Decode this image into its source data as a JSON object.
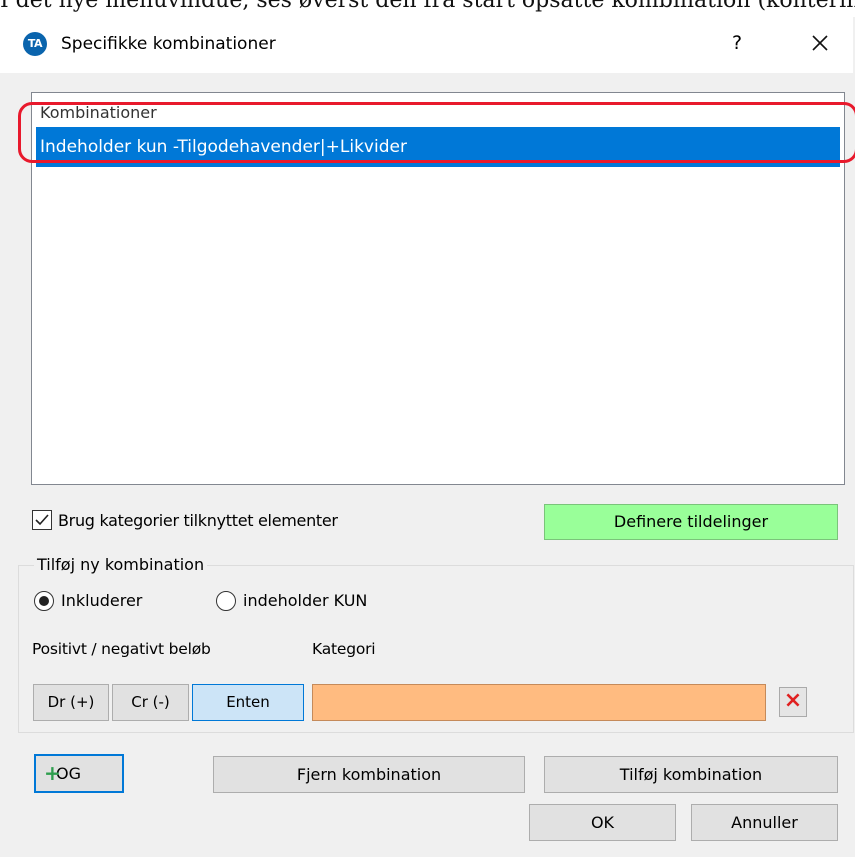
{
  "caption": "I det nye menuvindue, ses øverst den fra start opsatte kombination (konteringen",
  "window": {
    "app_icon_text": "TA",
    "title": "Specifikke kombinationer",
    "help_label": "?",
    "close_label": "Close"
  },
  "list": {
    "header": "Kombinationer",
    "rows": [
      {
        "label": "Indeholder kun -Tilgodehavender|+Likvider",
        "selected": true
      }
    ]
  },
  "use_categories": {
    "label": "Brug kategorier tilknyttet elementer",
    "checked": true
  },
  "define_button": "Definere tildelinger",
  "new_combination": {
    "legend": "Tilføj ny kombination",
    "radio_options": [
      {
        "label": "Inkluderer",
        "selected": true
      },
      {
        "label": "indeholder KUN",
        "selected": false
      }
    ],
    "amount_label": "Positivt / negativt beløb",
    "category_label": "Kategori",
    "amount_buttons": [
      {
        "label": "Dr (+)",
        "active": false
      },
      {
        "label": "Cr (-)",
        "active": false
      },
      {
        "label": "Enten",
        "active": true
      }
    ],
    "category_value": "",
    "clear_icon": "x-icon"
  },
  "footer": {
    "and_button": "OG",
    "remove_button": "Fjern kombination",
    "add_button": "Tilføj kombination",
    "ok_button": "OK",
    "cancel_button": "Annuller"
  },
  "colors": {
    "selection": "#0078d7",
    "define_button": "#99ff99",
    "category_field": "#ffbb80",
    "highlight_outline": "#e8192c",
    "plus_icon": "#2e9e4e"
  }
}
